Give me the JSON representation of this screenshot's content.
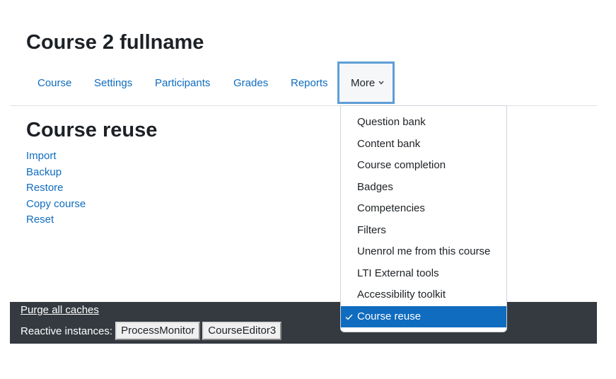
{
  "course": {
    "title": "Course 2 fullname"
  },
  "nav": {
    "items": [
      {
        "label": "Course"
      },
      {
        "label": "Settings"
      },
      {
        "label": "Participants"
      },
      {
        "label": "Grades"
      },
      {
        "label": "Reports"
      }
    ],
    "more_label": "More"
  },
  "section": {
    "title": "Course reuse",
    "links": [
      {
        "label": "Import"
      },
      {
        "label": "Backup"
      },
      {
        "label": "Restore"
      },
      {
        "label": "Copy course"
      },
      {
        "label": "Reset"
      }
    ]
  },
  "dropdown": {
    "items": [
      {
        "label": "Question bank"
      },
      {
        "label": "Content bank"
      },
      {
        "label": "Course completion"
      },
      {
        "label": "Badges"
      },
      {
        "label": "Competencies"
      },
      {
        "label": "Filters"
      },
      {
        "label": "Unenrol me from this course"
      },
      {
        "label": "LTI External tools"
      },
      {
        "label": "Accessibility toolkit"
      },
      {
        "label": "Course reuse",
        "active": true
      }
    ],
    "check_icon": "check-icon"
  },
  "footer": {
    "purge_label": "Purge all caches",
    "reactive_label": "Reactive instances:",
    "buttons": [
      {
        "label": "ProcessMonitor"
      },
      {
        "label": "CourseEditor3"
      }
    ]
  },
  "colors": {
    "link": "#0f6cbf",
    "active_bg": "#0f6cbf",
    "footer_bg": "#343a40",
    "focus_border": "#5e9ed6"
  }
}
